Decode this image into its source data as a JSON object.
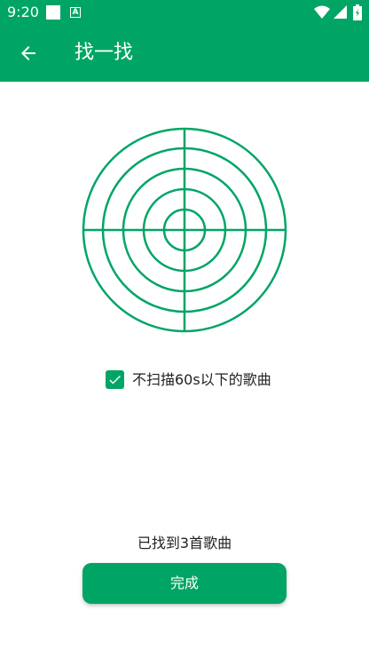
{
  "status_bar": {
    "time": "9:20",
    "icons": [
      "square-notification-icon",
      "a-notification-icon",
      "wifi-icon",
      "cell-signal-icon",
      "battery-icon"
    ],
    "background": "#00a565"
  },
  "toolbar": {
    "title": "找一找",
    "back_icon": "arrow-left-icon",
    "background": "#00a565"
  },
  "radar": {
    "icon": "radar-target-icon",
    "color": "#00a565"
  },
  "filter": {
    "checked": true,
    "label": "不扫描60s以下的歌曲"
  },
  "result": {
    "text": "已找到3首歌曲"
  },
  "done_button": {
    "label": "完成"
  },
  "colors": {
    "accent": "#00a565",
    "text": "#222222"
  }
}
